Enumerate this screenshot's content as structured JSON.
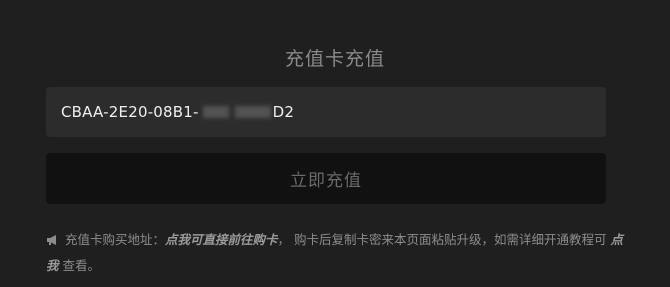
{
  "title": "充值卡充值",
  "card_input": {
    "value_prefix": "CBAA-2E20-08B1-",
    "value_suffix": "D2"
  },
  "submit_button": {
    "label": "立即充值"
  },
  "notice": {
    "icon": "megaphone-icon",
    "text_1": "充值卡购买地址：",
    "link_1": "点我可直接前往购卡",
    "text_2": "，  购卡后复制卡密来本页面粘贴升级，如需详细开通教程可 ",
    "link_2": "点我",
    "text_3": " 查看。"
  }
}
